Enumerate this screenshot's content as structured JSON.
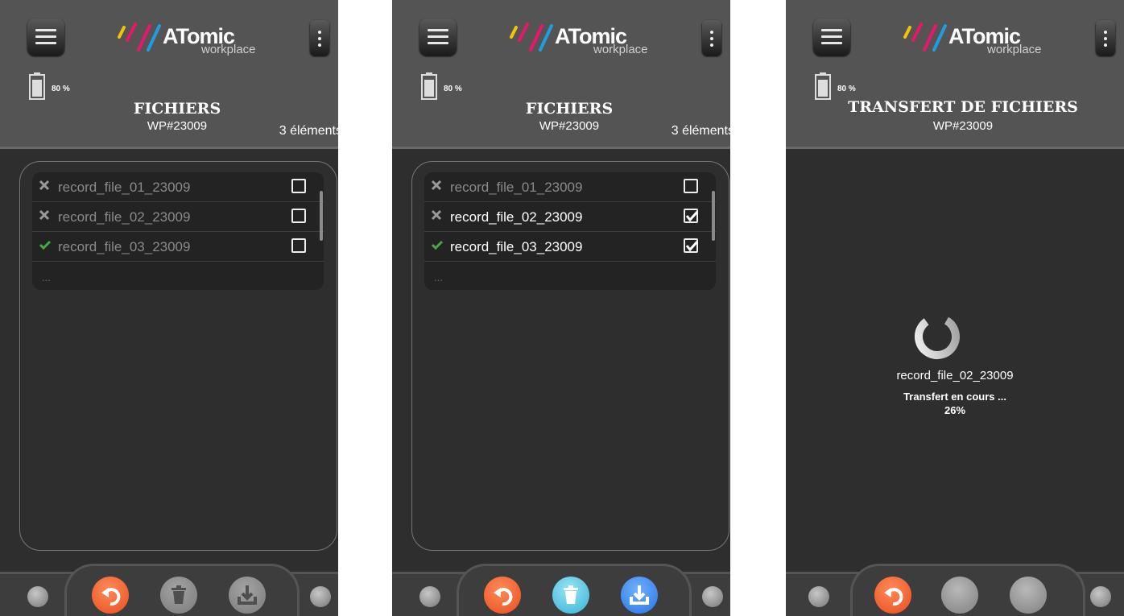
{
  "app": {
    "logo_text": "ATomic",
    "logo_sub": "workplace",
    "battery": "80 %",
    "device": "WP#23009"
  },
  "screens": [
    {
      "title": "FICHIERS",
      "count": "3 éléments",
      "files": [
        {
          "name": "record_file_01_23009",
          "status": "error",
          "checked": false
        },
        {
          "name": "record_file_02_23009",
          "status": "error",
          "checked": false
        },
        {
          "name": "record_file_03_23009",
          "status": "ok",
          "checked": false
        }
      ],
      "more": "..."
    },
    {
      "title": "FICHIERS",
      "count": "3 éléments",
      "files": [
        {
          "name": "record_file_01_23009",
          "status": "error",
          "checked": false
        },
        {
          "name": "record_file_02_23009",
          "status": "error",
          "checked": true
        },
        {
          "name": "record_file_03_23009",
          "status": "ok",
          "checked": true
        }
      ],
      "more": "..."
    },
    {
      "title": "TRANSFERT DE FICHIERS",
      "transfer": {
        "file": "record_file_02_23009",
        "state": "Transfert en cours ...",
        "percent": "26%",
        "progress": 0.26
      }
    }
  ],
  "colors": {
    "accent_undo": "#e84e1c",
    "delete_active": "#34b3d6",
    "download_active": "#2774e4",
    "ok": "#3fae3f",
    "error": "#9a9a9a"
  },
  "icons": [
    "menu-icon",
    "more-vertical-icon",
    "battery-icon",
    "close-icon",
    "check-icon",
    "undo-icon",
    "trash-icon",
    "download-icon",
    "spinner-icon"
  ]
}
